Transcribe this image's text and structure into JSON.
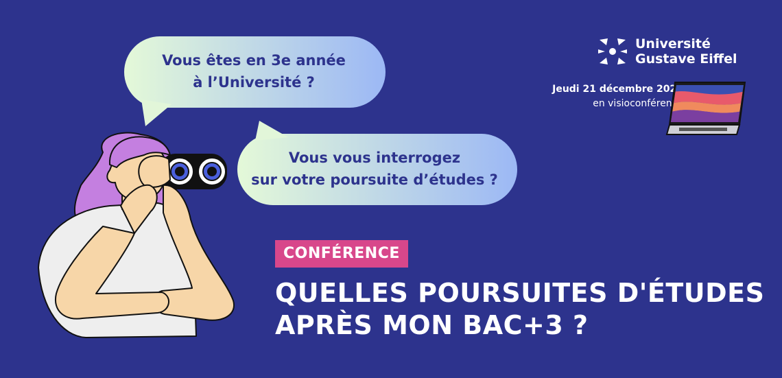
{
  "bubbles": {
    "first": {
      "line1": "Vous êtes en 3e année",
      "line2": "à l’Université ?"
    },
    "second": {
      "line1": "Vous vous interrogez",
      "line2": "sur votre poursuite d’études ?"
    }
  },
  "brand": {
    "line1": "Université",
    "line2": "Gustave Eiffel",
    "icon": "university-logo-icon"
  },
  "event": {
    "date": "Jeudi 21 décembre 2023",
    "mode": "en visioconférence",
    "icon": "laptop-icon"
  },
  "tag": "CONFÉRENCE",
  "title": {
    "line1": "QUELLES POURSUITES D'ÉTUDES",
    "line2": "APRÈS MON BAC+3 ?"
  },
  "colors": {
    "background": "#2d338d",
    "tag": "#d8478b",
    "text": "#ffffff",
    "bubble_text": "#2d338d"
  }
}
